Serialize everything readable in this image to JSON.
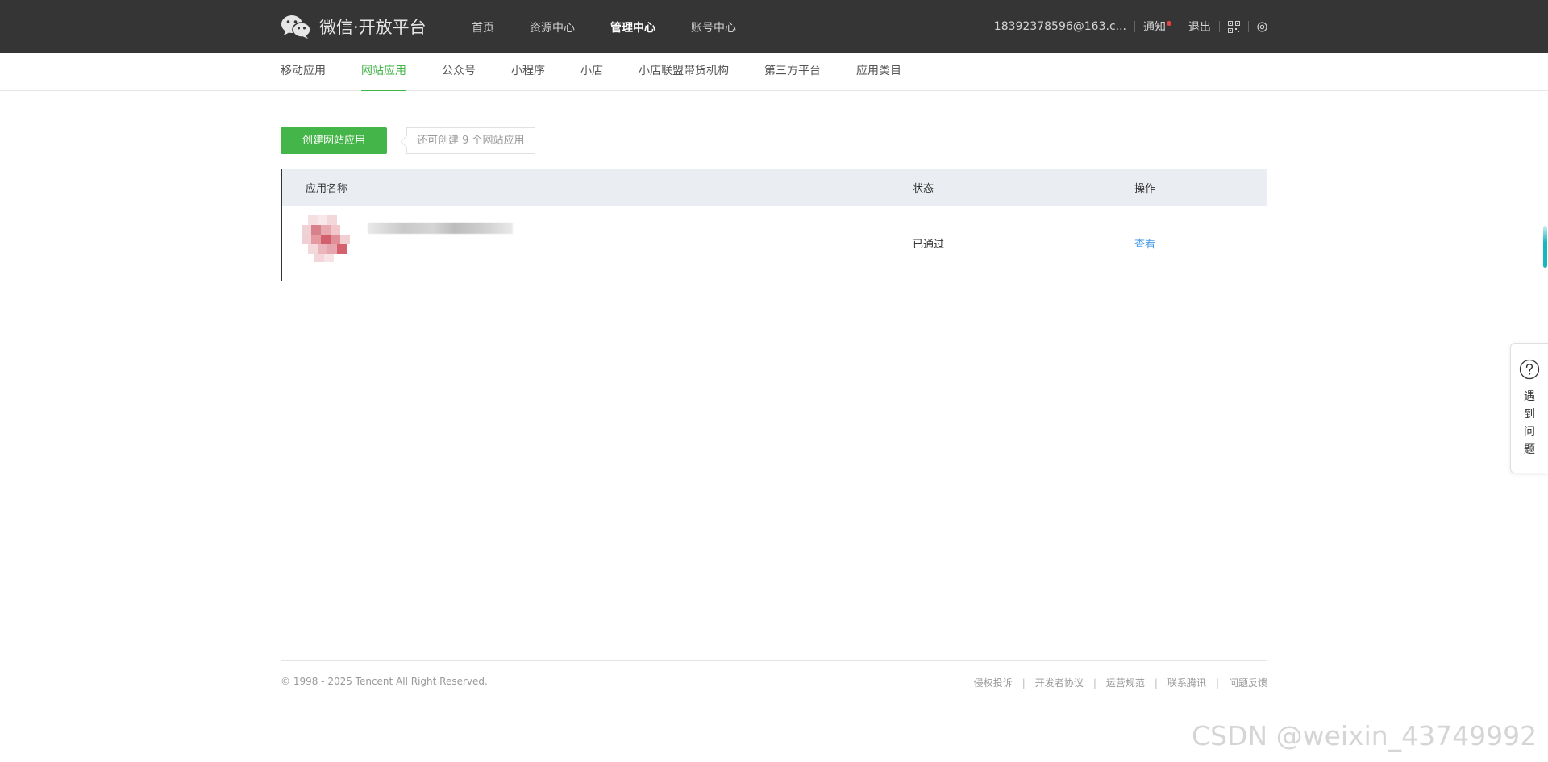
{
  "header": {
    "logo_text": "微信·开放平台",
    "nav": [
      "首页",
      "资源中心",
      "管理中心",
      "账号中心"
    ],
    "account_email": "18392378596@163.c...",
    "notify_label": "通知",
    "logout_label": "退出"
  },
  "subnav": [
    "移动应用",
    "网站应用",
    "公众号",
    "小程序",
    "小店",
    "小店联盟带货机构",
    "第三方平台",
    "应用类目"
  ],
  "toolbar": {
    "create_label": "创建网站应用",
    "quota_tip": "还可创建 9 个网站应用"
  },
  "table": {
    "columns": [
      "应用名称",
      "状态",
      "操作"
    ],
    "rows": [
      {
        "status": "已通过",
        "action": "查看"
      }
    ]
  },
  "footer": {
    "copyright": "© 1998 - 2025 Tencent All Right Reserved.",
    "links": [
      "侵权投诉",
      "开发者协议",
      "运营规范",
      "联系腾讯",
      "问题反馈"
    ]
  },
  "help": {
    "label": "遇到问题"
  },
  "watermark": "CSDN @weixin_43749992",
  "colors": {
    "accent": "#44b549",
    "topbar": "#353535",
    "link": "#459ae9"
  }
}
